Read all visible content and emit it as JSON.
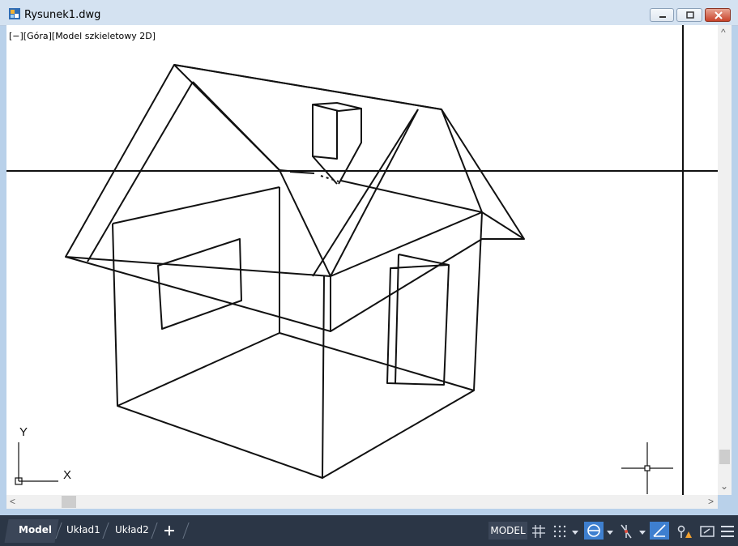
{
  "window": {
    "title": "Rysunek1.dwg",
    "app_icon": "autocad-file-icon",
    "controls": [
      "minimize-icon",
      "restore-icon",
      "close-icon"
    ]
  },
  "viewport": {
    "label": "[−][Góra][Model szkieletowy 2D]",
    "ucs_x_label": "X",
    "ucs_y_label": "Y"
  },
  "tabs": [
    {
      "label": "Model",
      "active": true
    },
    {
      "label": "Układ1",
      "active": false
    },
    {
      "label": "Układ2",
      "active": false
    }
  ],
  "add_tab_icon": "plus-icon",
  "status": {
    "model_label": "MODEL",
    "icons": [
      "grid-icon",
      "snap-icon",
      "snap-dropdown-icon",
      "ortho-icon",
      "ortho-dropdown-icon",
      "polar-icon",
      "polar-dropdown-icon",
      "osnap-icon",
      "annotation-icon",
      "fullscreen-icon",
      "menu-icon"
    ]
  },
  "colors": {
    "statusbar": "#2b3646",
    "accent_active": "#3e7fcf",
    "titlebar": "#d4e2f1",
    "close_button": "#c9432a"
  }
}
